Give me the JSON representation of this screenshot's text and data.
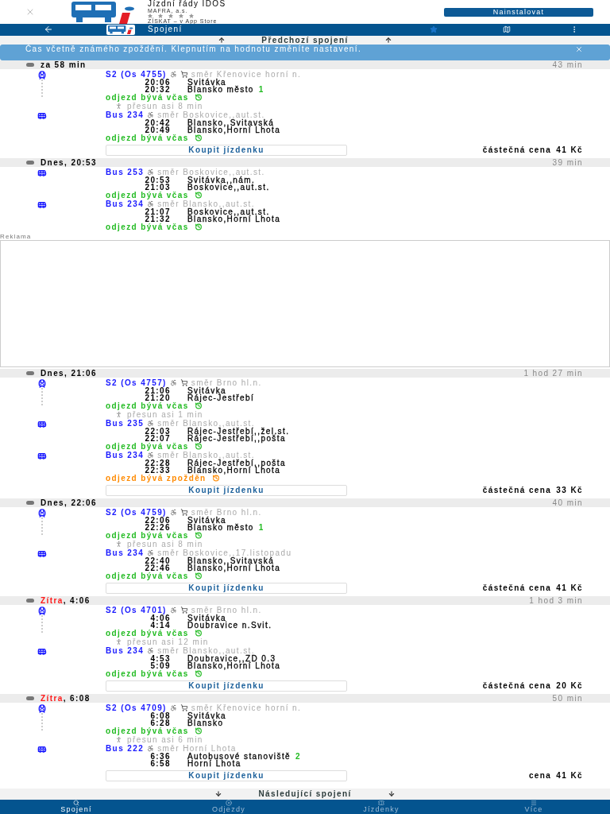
{
  "app_banner": {
    "title": "Jízdní řády IDOS",
    "publisher": "MAFRA, a.s.",
    "store": "ZÍSKAT – v App Store",
    "install": "Nainstalovat"
  },
  "nav": {
    "title": "Spojení"
  },
  "previous": "Předchozí spojení",
  "info": "Čas včetně známého zpoždění. Klepnutím na hodnotu změníte nastavení.",
  "items": [
    {
      "kind": "connection",
      "day": "za 58 min",
      "day_red": false,
      "duration": "43 min",
      "legs": [
        {
          "kind": "train",
          "line": "S2 (Os 4755)",
          "cart": true,
          "direction": "směr Křenovice horní n.",
          "stops": [
            {
              "time": "20:06",
              "name": "Svitávka"
            },
            {
              "time": "20:32",
              "name": "Blansko město",
              "platform": "1"
            }
          ],
          "status": "odjezd bývá včas",
          "delayed": false,
          "transfer": "přesun asi 8 min"
        },
        {
          "kind": "bus",
          "line": "Bus 234",
          "cart": false,
          "direction": "směr Boskovice,,aut.st.",
          "stops": [
            {
              "time": "20:42",
              "name": "Blansko,,Svitavská"
            },
            {
              "time": "20:49",
              "name": "Blansko,Horní Lhota"
            }
          ],
          "status": "odjezd bývá včas",
          "delayed": false
        }
      ],
      "buy": "Koupit jízdenku",
      "price_label": "částečná cena",
      "price": "41 Kč"
    },
    {
      "kind": "connection",
      "day": "Dnes",
      "rest": ", 20:53",
      "day_red": false,
      "duration": "39 min",
      "legs": [
        {
          "kind": "bus",
          "line": "Bus 253",
          "cart": false,
          "direction": "směr Boskovice,,aut.st.",
          "stops": [
            {
              "time": "20:53",
              "name": "Svitávka,,nám."
            },
            {
              "time": "21:03",
              "name": "Boskovice,,aut.st."
            }
          ],
          "status": "odjezd bývá včas",
          "delayed": false
        },
        {
          "kind": "bus",
          "line": "Bus 234",
          "cart": false,
          "direction": "směr Blansko,,aut.st.",
          "stops": [
            {
              "time": "21:07",
              "name": "Boskovice,,aut.st."
            },
            {
              "time": "21:32",
              "name": "Blansko,Horní Lhota"
            }
          ],
          "status": "odjezd bývá včas",
          "delayed": false
        }
      ]
    },
    {
      "kind": "ad",
      "label": "Reklama"
    },
    {
      "kind": "connection",
      "day": "Dnes",
      "rest": ", 21:06",
      "day_red": false,
      "duration": "1 hod 27 min",
      "legs": [
        {
          "kind": "train",
          "line": "S2 (Os 4757)",
          "cart": true,
          "direction": "směr Brno hl.n.",
          "stops": [
            {
              "time": "21:06",
              "name": "Svitávka"
            },
            {
              "time": "21:20",
              "name": "Rájec-Jestřebí"
            }
          ],
          "status": "odjezd bývá včas",
          "delayed": false,
          "transfer": "přesun asi 1 min"
        },
        {
          "kind": "bus",
          "line": "Bus 235",
          "cart": false,
          "direction": "směr Blansko,,aut.st.",
          "stops": [
            {
              "time": "22:03",
              "name": "Rájec-Jestřebí,,žel.st."
            },
            {
              "time": "22:07",
              "name": "Rájec-Jestřebí,,pošta"
            }
          ],
          "status": "odjezd bývá včas",
          "delayed": false
        },
        {
          "kind": "bus",
          "line": "Bus 234",
          "cart": false,
          "direction": "směr Blansko,,aut.st.",
          "stops": [
            {
              "time": "22:28",
              "name": "Rájec-Jestřebí,,pošta"
            },
            {
              "time": "22:33",
              "name": "Blansko,Horní Lhota"
            }
          ],
          "status": "odjezd bývá zpožděn",
          "delayed": true
        }
      ],
      "buy": "Koupit jízdenku",
      "price_label": "částečná cena",
      "price": "33 Kč"
    },
    {
      "kind": "connection",
      "day": "Dnes",
      "rest": ", 22:06",
      "day_red": false,
      "duration": "40 min",
      "legs": [
        {
          "kind": "train",
          "line": "S2 (Os 4759)",
          "cart": true,
          "direction": "směr Brno hl.n.",
          "stops": [
            {
              "time": "22:06",
              "name": "Svitávka"
            },
            {
              "time": "22:26",
              "name": "Blansko město",
              "platform": "1"
            }
          ],
          "status": "odjezd bývá včas",
          "delayed": false,
          "transfer": "přesun asi 8 min"
        },
        {
          "kind": "bus",
          "line": "Bus 234",
          "cart": false,
          "direction": "směr Boskovice,,17.listopadu",
          "stops": [
            {
              "time": "22:40",
              "name": "Blansko,,Svitavská"
            },
            {
              "time": "22:46",
              "name": "Blansko,Horní Lhota"
            }
          ],
          "status": "odjezd bývá včas",
          "delayed": false
        }
      ],
      "buy": "Koupit jízdenku",
      "price_label": "částečná cena",
      "price": "41 Kč"
    },
    {
      "kind": "connection",
      "day": "Zítra",
      "rest": ", 4:06",
      "day_red": true,
      "duration": "1 hod 3 min",
      "legs": [
        {
          "kind": "train",
          "line": "S2 (Os 4701)",
          "cart": true,
          "direction": "směr Brno hl.n.",
          "stops": [
            {
              "time": "4:06",
              "name": "Svitávka"
            },
            {
              "time": "4:14",
              "name": "Doubravice n.Svit."
            }
          ],
          "status": "odjezd bývá včas",
          "delayed": false,
          "transfer": "přesun asi 12 min"
        },
        {
          "kind": "bus",
          "line": "Bus 234",
          "cart": false,
          "direction": "směr Blansko,,aut.st.",
          "stops": [
            {
              "time": "4:53",
              "name": "Doubravice,,ZD 0.3"
            },
            {
              "time": "5:09",
              "name": "Blansko,Horní Lhota"
            }
          ],
          "status": "odjezd bývá včas",
          "delayed": false
        }
      ],
      "buy": "Koupit jízdenku",
      "price_label": "částečná cena",
      "price": "20 Kč"
    },
    {
      "kind": "connection",
      "day": "Zítra",
      "rest": ", 6:08",
      "day_red": true,
      "duration": "50 min",
      "legs": [
        {
          "kind": "train",
          "line": "S2 (Os 4709)",
          "cart": true,
          "direction": "směr Křenovice horní n.",
          "stops": [
            {
              "time": "6:08",
              "name": "Svitávka"
            },
            {
              "time": "6:28",
              "name": "Blansko"
            }
          ],
          "status": "odjezd bývá včas",
          "delayed": false,
          "transfer": "přesun asi 6 min"
        },
        {
          "kind": "bus",
          "line": "Bus 222",
          "cart": false,
          "direction": "směr Horní Lhota",
          "stops": [
            {
              "time": "6:36",
              "name": "Autobusové stanoviště",
              "platform": "2"
            },
            {
              "time": "6:58",
              "name": "Horní Lhota"
            }
          ]
        }
      ],
      "buy": "Koupit jízdenku",
      "price_label": "cena",
      "price": "41 Kč"
    }
  ],
  "next": "Následující spojení",
  "tabs": [
    {
      "label": "Spojení",
      "kind": "search",
      "selected": true
    },
    {
      "label": "Odjezdy",
      "kind": "departures",
      "selected": false
    },
    {
      "label": "Jízdenky",
      "kind": "tickets",
      "selected": false
    },
    {
      "label": "Více",
      "kind": "more",
      "selected": false
    }
  ]
}
